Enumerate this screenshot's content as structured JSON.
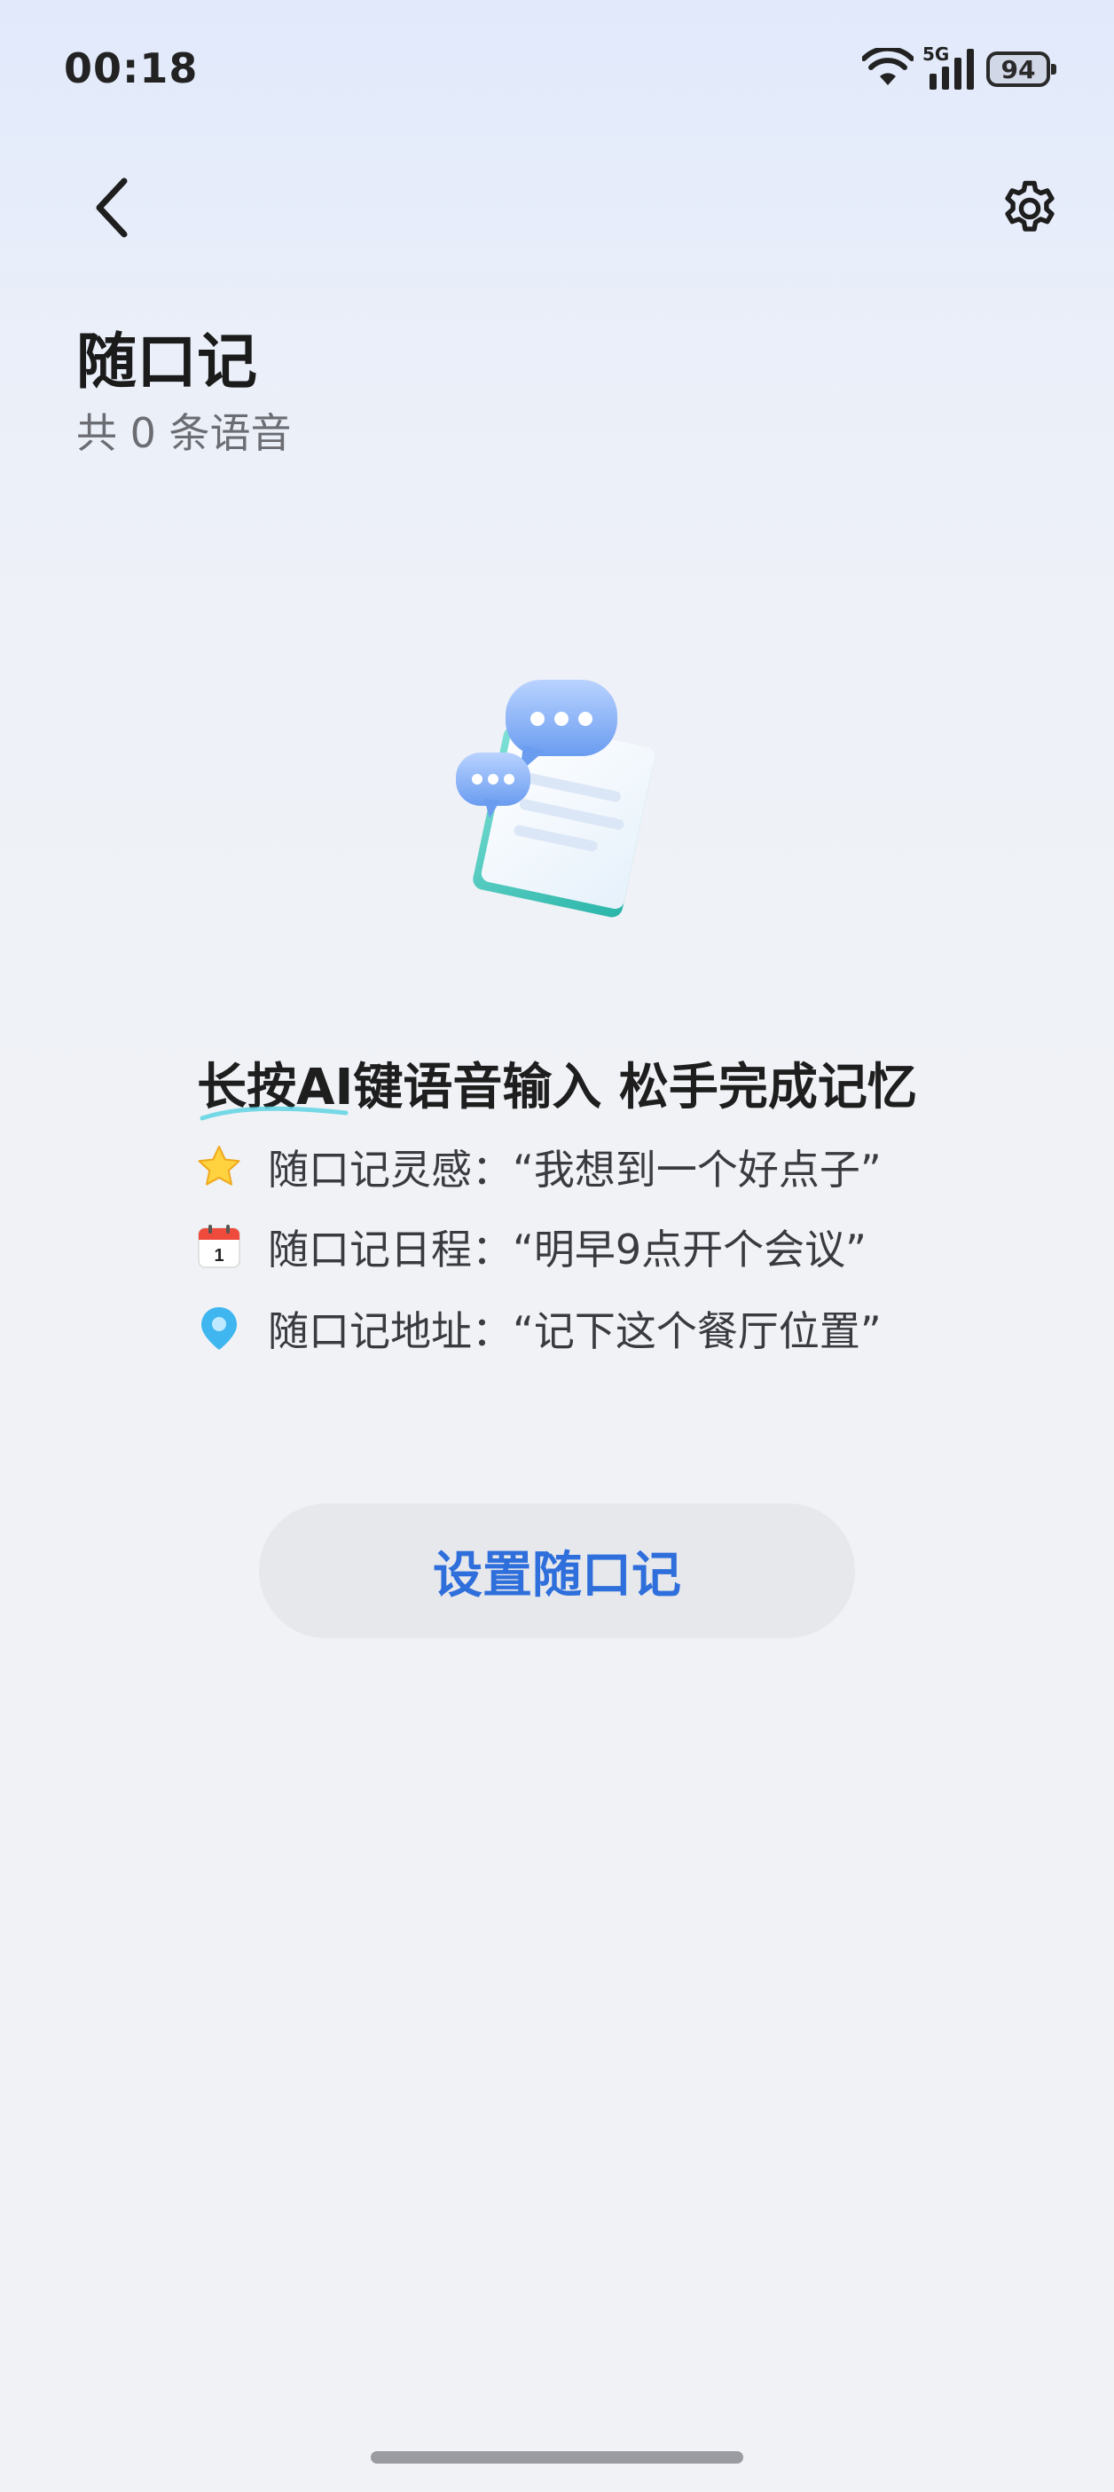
{
  "status_bar": {
    "time": "00:18",
    "network_label": "5G",
    "battery_level": "94",
    "icons": [
      "wifi-icon",
      "signal-icon",
      "battery-icon"
    ]
  },
  "header": {
    "back_icon": "chevron-left-icon",
    "settings_icon": "gear-icon",
    "title": "随口记",
    "subtitle": "共 0 条语音"
  },
  "empty_state": {
    "illustration": "voice-notes-illustration",
    "headline": "长按AI键语音输入 松手完成记忆",
    "hints": [
      {
        "icon": "star-icon",
        "text": "随口记灵感：“我想到一个好点子”"
      },
      {
        "icon": "calendar-icon",
        "calendar_day": "1",
        "text": "随口记日程：“明早9点开个会议”"
      },
      {
        "icon": "location-pin-icon",
        "text": "随口记地址：“记下这个餐厅位置”"
      }
    ]
  },
  "actions": {
    "setup_label": "设置随口记"
  },
  "colors": {
    "accent": "#2f6fdb",
    "button_bg": "#e7e8ec",
    "subtitle": "#6b6d73"
  }
}
